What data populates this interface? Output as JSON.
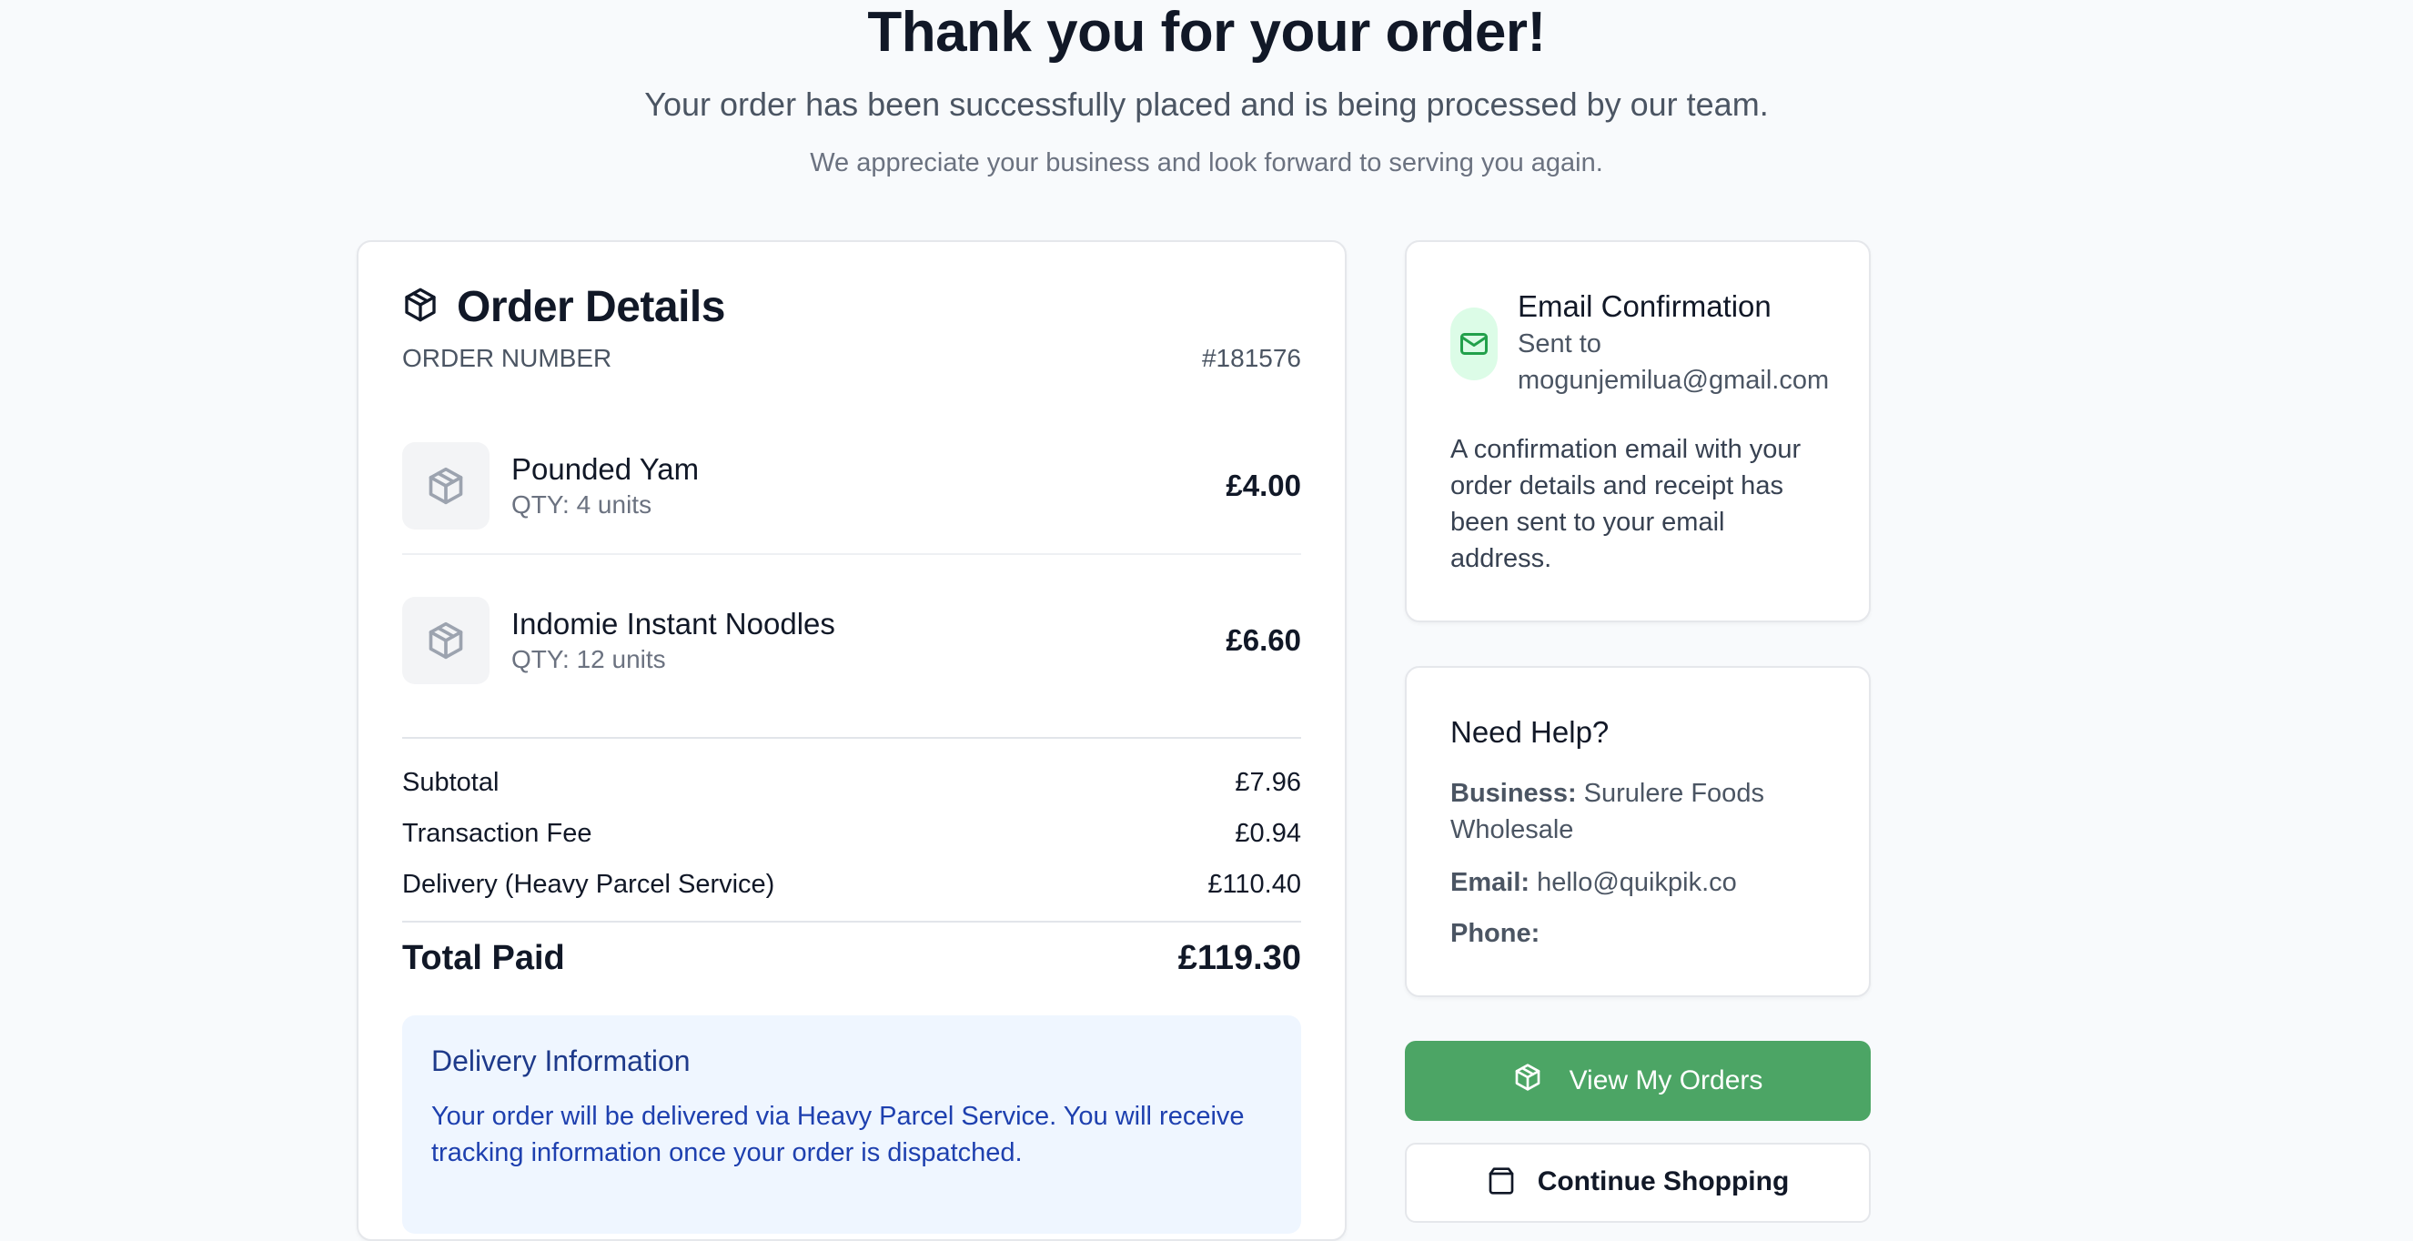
{
  "hero": {
    "title": "Thank you for your order!",
    "subtitle": "Your order has been successfully placed and is being processed by our team.",
    "note": "We appreciate your business and look forward to serving you again."
  },
  "order": {
    "title": "Order Details",
    "number_label": "ORDER NUMBER",
    "number": "#181576",
    "items": [
      {
        "name": "Pounded Yam",
        "qty": "QTY: 4 units",
        "price": "£4.00",
        "icon": "package-icon"
      },
      {
        "name": "Indomie Instant Noodles",
        "qty": "QTY: 12 units",
        "price": "£6.60",
        "icon": "package-icon"
      }
    ],
    "summary": [
      {
        "label": "Subtotal",
        "value": "£7.96"
      },
      {
        "label": "Transaction Fee",
        "value": "£0.94"
      },
      {
        "label": "Delivery (Heavy Parcel Service)",
        "value": "£110.40"
      }
    ],
    "total_label": "Total Paid",
    "total_value": "£119.30"
  },
  "delivery": {
    "title": "Delivery Information",
    "text": "Your order will be delivered via Heavy Parcel Service. You will receive tracking information once your order is dispatched."
  },
  "email": {
    "title": "Email Confirmation",
    "sent_to_label": "Sent to",
    "address": "mogunjemilua@gmail.com",
    "body": "A confirmation email with your order details and receipt has been sent to your email address."
  },
  "help": {
    "title": "Need Help?",
    "business_label": "Business:",
    "business_value": "Surulere Foods Wholesale",
    "email_label": "Email:",
    "email_value": "hello@quikpik.co",
    "phone_label": "Phone:",
    "phone_value": ""
  },
  "actions": {
    "view_orders": "View My Orders",
    "continue_shopping": "Continue Shopping"
  },
  "colors": {
    "accent_green": "#4ca565",
    "delivery_bg": "#eff6ff",
    "delivery_text": "#1e40af"
  }
}
